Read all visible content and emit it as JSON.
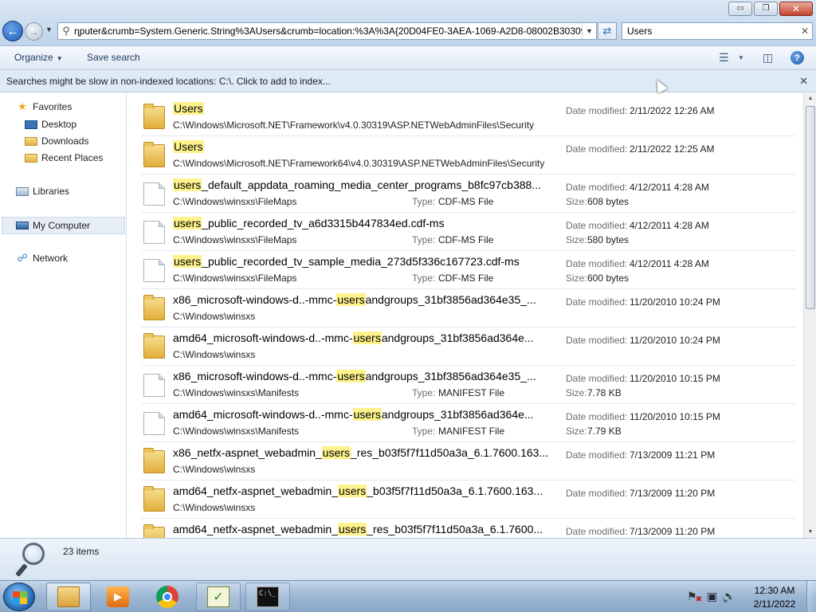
{
  "window": {
    "controls": {
      "minimize": "▭",
      "maximize": "❐",
      "close": "✕"
    }
  },
  "address": {
    "path": "ɳputer&crumb=System.Generic.String%3AUsers&crumb=location:%3A%3A{20D04FE0-3AEA-1069-A2D8-08002B30309D}"
  },
  "search": {
    "value": "Users"
  },
  "toolbar": {
    "organize": "Organize",
    "save_search": "Save search"
  },
  "infobar": {
    "message": "Searches might be slow in non-indexed locations: C:\\. Click to add to index..."
  },
  "nav": {
    "favorites": "Favorites",
    "desktop": "Desktop",
    "downloads": "Downloads",
    "recent_places": "Recent Places",
    "libraries": "Libraries",
    "my_computer": "My Computer",
    "network": "Network"
  },
  "labels": {
    "date_modified": "Date modified:",
    "type": "Type:",
    "size": "Size:"
  },
  "files": [
    {
      "kind": "folder",
      "name_pre": "",
      "name_hit": "Users",
      "name_post": "",
      "path": "C:\\Windows\\Microsoft.NET\\Framework\\v4.0.30319\\ASP.NETWebAdminFiles\\Security",
      "date": "2/11/2022 12:26 AM",
      "type": "",
      "size": ""
    },
    {
      "kind": "folder",
      "name_pre": "",
      "name_hit": "Users",
      "name_post": "",
      "path": "C:\\Windows\\Microsoft.NET\\Framework64\\v4.0.30319\\ASP.NETWebAdminFiles\\Security",
      "date": "2/11/2022 12:25 AM",
      "type": "",
      "size": ""
    },
    {
      "kind": "file",
      "name_pre": "",
      "name_hit": "users",
      "name_post": "_default_appdata_roaming_media_center_programs_b8fc97cb388...",
      "path": "C:\\Windows\\winsxs\\FileMaps",
      "date": "4/12/2011 4:28 AM",
      "type": "CDF-MS File",
      "size": "608 bytes"
    },
    {
      "kind": "file",
      "name_pre": "",
      "name_hit": "users",
      "name_post": "_public_recorded_tv_a6d3315b447834ed.cdf-ms",
      "path": "C:\\Windows\\winsxs\\FileMaps",
      "date": "4/12/2011 4:28 AM",
      "type": "CDF-MS File",
      "size": "580 bytes"
    },
    {
      "kind": "file",
      "name_pre": "",
      "name_hit": "users",
      "name_post": "_public_recorded_tv_sample_media_273d5f336c167723.cdf-ms",
      "path": "C:\\Windows\\winsxs\\FileMaps",
      "date": "4/12/2011 4:28 AM",
      "type": "CDF-MS File",
      "size": "600 bytes"
    },
    {
      "kind": "folder",
      "name_pre": "x86_microsoft-windows-d..-mmc-",
      "name_hit": "users",
      "name_post": "andgroups_31bf3856ad364e35_...",
      "path": "C:\\Windows\\winsxs",
      "date": "11/20/2010 10:24 PM",
      "type": "",
      "size": ""
    },
    {
      "kind": "folder",
      "name_pre": "amd64_microsoft-windows-d..-mmc-",
      "name_hit": "users",
      "name_post": "andgroups_31bf3856ad364e...",
      "path": "C:\\Windows\\winsxs",
      "date": "11/20/2010 10:24 PM",
      "type": "",
      "size": ""
    },
    {
      "kind": "file",
      "name_pre": "x86_microsoft-windows-d..-mmc-",
      "name_hit": "users",
      "name_post": "andgroups_31bf3856ad364e35_...",
      "path": "C:\\Windows\\winsxs\\Manifests",
      "date": "11/20/2010 10:15 PM",
      "type": "MANIFEST File",
      "size": "7.78 KB"
    },
    {
      "kind": "file",
      "name_pre": "amd64_microsoft-windows-d..-mmc-",
      "name_hit": "users",
      "name_post": "andgroups_31bf3856ad364e...",
      "path": "C:\\Windows\\winsxs\\Manifests",
      "date": "11/20/2010 10:15 PM",
      "type": "MANIFEST File",
      "size": "7.79 KB"
    },
    {
      "kind": "folder",
      "name_pre": "x86_netfx-aspnet_webadmin_",
      "name_hit": "users",
      "name_post": "_res_b03f5f7f11d50a3a_6.1.7600.163...",
      "path": "C:\\Windows\\winsxs",
      "date": "7/13/2009 11:21 PM",
      "type": "",
      "size": ""
    },
    {
      "kind": "folder",
      "name_pre": "amd64_netfx-aspnet_webadmin_",
      "name_hit": "users",
      "name_post": "_b03f5f7f11d50a3a_6.1.7600.163...",
      "path": "C:\\Windows\\winsxs",
      "date": "7/13/2009 11:20 PM",
      "type": "",
      "size": ""
    },
    {
      "kind": "folder",
      "name_pre": "amd64_netfx-aspnet_webadmin_",
      "name_hit": "users",
      "name_post": "_res_b03f5f7f11d50a3a_6.1.7600...",
      "path": "",
      "date": "7/13/2009 11:20 PM",
      "type": "",
      "size": ""
    }
  ],
  "status": {
    "count": "23 items"
  },
  "taskbar": {
    "cmd_text": "C:\\_",
    "clock_time": "12:30 AM",
    "clock_date": "2/11/2022"
  },
  "colors": {
    "highlight": "#fdf28c",
    "window_chrome": "#c9dbef",
    "taskbar": "#9bb6d3"
  }
}
